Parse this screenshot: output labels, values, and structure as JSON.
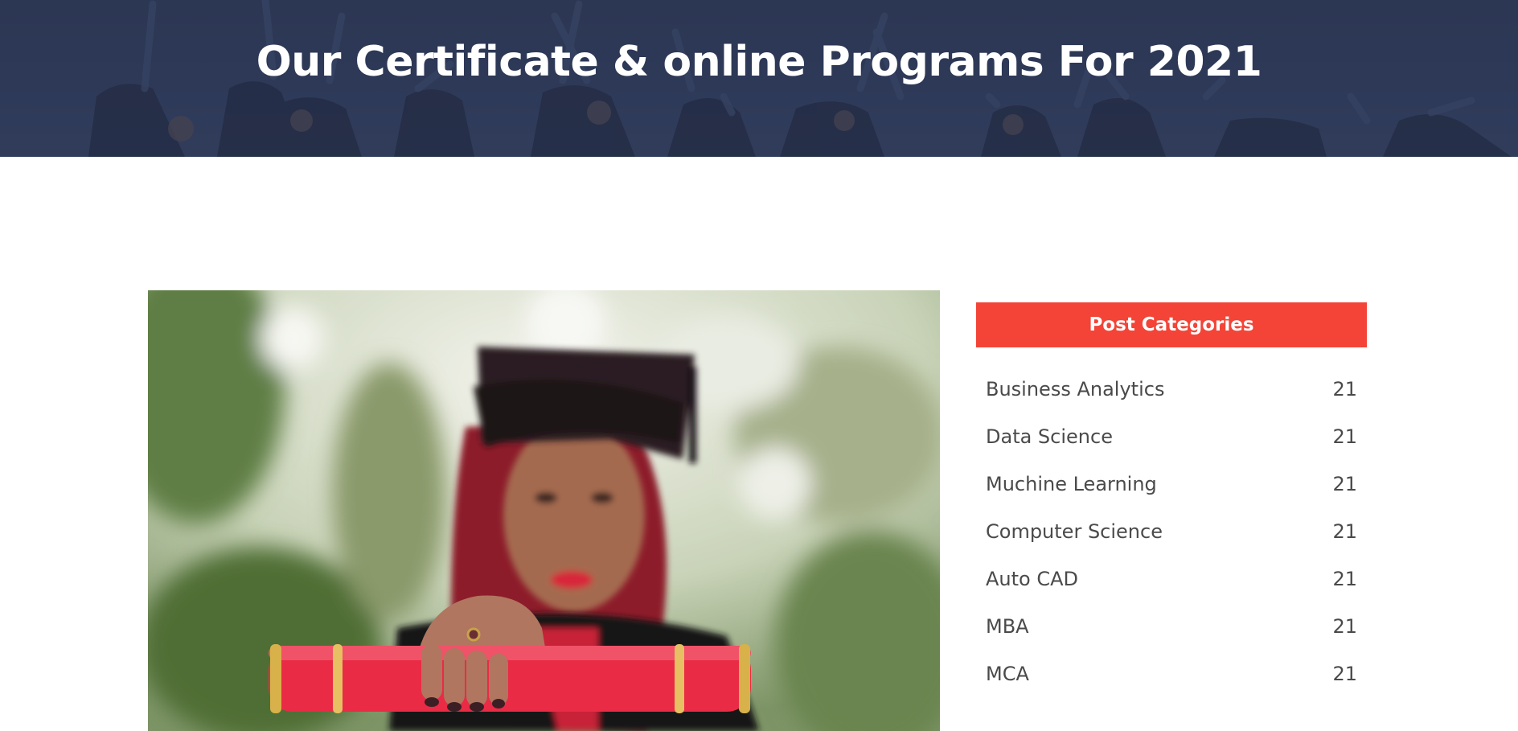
{
  "hero": {
    "title": "Our Certificate & online Programs For 2021"
  },
  "main": {
    "featured_image": {
      "icon": "graduate-photo"
    }
  },
  "sidebar": {
    "header": "Post Categories",
    "categories": [
      {
        "label": "Business Analytics",
        "count": "21"
      },
      {
        "label": "Data Science",
        "count": "21"
      },
      {
        "label": "Muchine Learning",
        "count": "21"
      },
      {
        "label": "Computer Science",
        "count": "21"
      },
      {
        "label": "Auto CAD",
        "count": "21"
      },
      {
        "label": "MBA",
        "count": "21"
      },
      {
        "label": "MCA",
        "count": "21"
      }
    ]
  },
  "colors": {
    "accent": "#f34437",
    "hero_overlay": "#2e3a58",
    "text": "#4a4a4a"
  }
}
